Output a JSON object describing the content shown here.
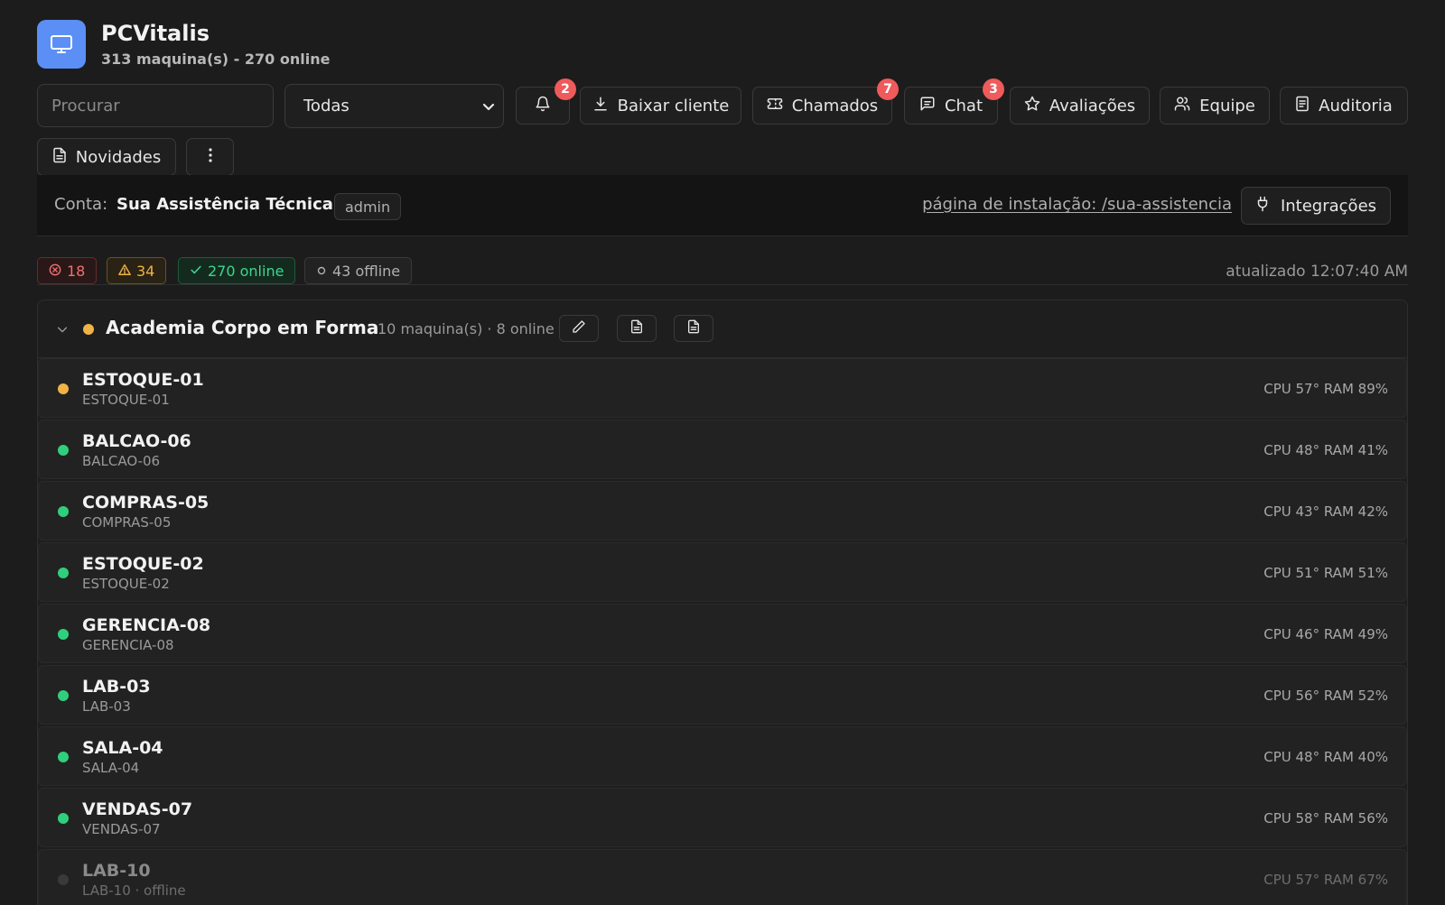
{
  "app": {
    "title": "PCVitalis",
    "subtitle": "313 maquina(s) - 270 online"
  },
  "toolbar": {
    "search_placeholder": "Procurar",
    "filter_value": "Todas",
    "notifications_count": "2",
    "download_label": "Baixar cliente",
    "tickets_label": "Chamados",
    "tickets_count": "7",
    "chat_label": "Chat",
    "chat_count": "3",
    "reviews_label": "Avaliações",
    "team_label": "Equipe",
    "audit_label": "Auditoria",
    "news_label": "Novidades"
  },
  "account": {
    "label": "Conta:",
    "name": "Sua Assistência Técnica",
    "role": "admin",
    "install_link": "página de instalação: /sua-assistencia",
    "integrations_label": "Integrações"
  },
  "status": {
    "critical": "18",
    "warnings": "34",
    "online": "270 online",
    "offline": "43 offline",
    "updated": "atualizado 12:07:40 AM"
  },
  "colors": {
    "online": "#2fcf7d",
    "warning": "#f0b347",
    "offline": "#3a3a3a",
    "accent": "#5b8ff5",
    "badge": "#ef5a5a"
  },
  "group": {
    "name": "Academia Corpo em Forma",
    "meta": "10 maquina(s) · 8 online",
    "machines": [
      {
        "name": "ESTOQUE-01",
        "host": "ESTOQUE-01",
        "stats": "CPU 57° RAM 89%",
        "status": "warning"
      },
      {
        "name": "BALCAO-06",
        "host": "BALCAO-06",
        "stats": "CPU 48° RAM 41%",
        "status": "online"
      },
      {
        "name": "COMPRAS-05",
        "host": "COMPRAS-05",
        "stats": "CPU 43° RAM 42%",
        "status": "online"
      },
      {
        "name": "ESTOQUE-02",
        "host": "ESTOQUE-02",
        "stats": "CPU 51° RAM 51%",
        "status": "online"
      },
      {
        "name": "GERENCIA-08",
        "host": "GERENCIA-08",
        "stats": "CPU 46° RAM 49%",
        "status": "online"
      },
      {
        "name": "LAB-03",
        "host": "LAB-03",
        "stats": "CPU 56° RAM 52%",
        "status": "online"
      },
      {
        "name": "SALA-04",
        "host": "SALA-04",
        "stats": "CPU 48° RAM 40%",
        "status": "online"
      },
      {
        "name": "VENDAS-07",
        "host": "VENDAS-07",
        "stats": "CPU 58° RAM 56%",
        "status": "online"
      },
      {
        "name": "LAB-10",
        "host": "LAB-10 · offline",
        "stats": "CPU 57° RAM 67%",
        "status": "offline"
      }
    ]
  }
}
